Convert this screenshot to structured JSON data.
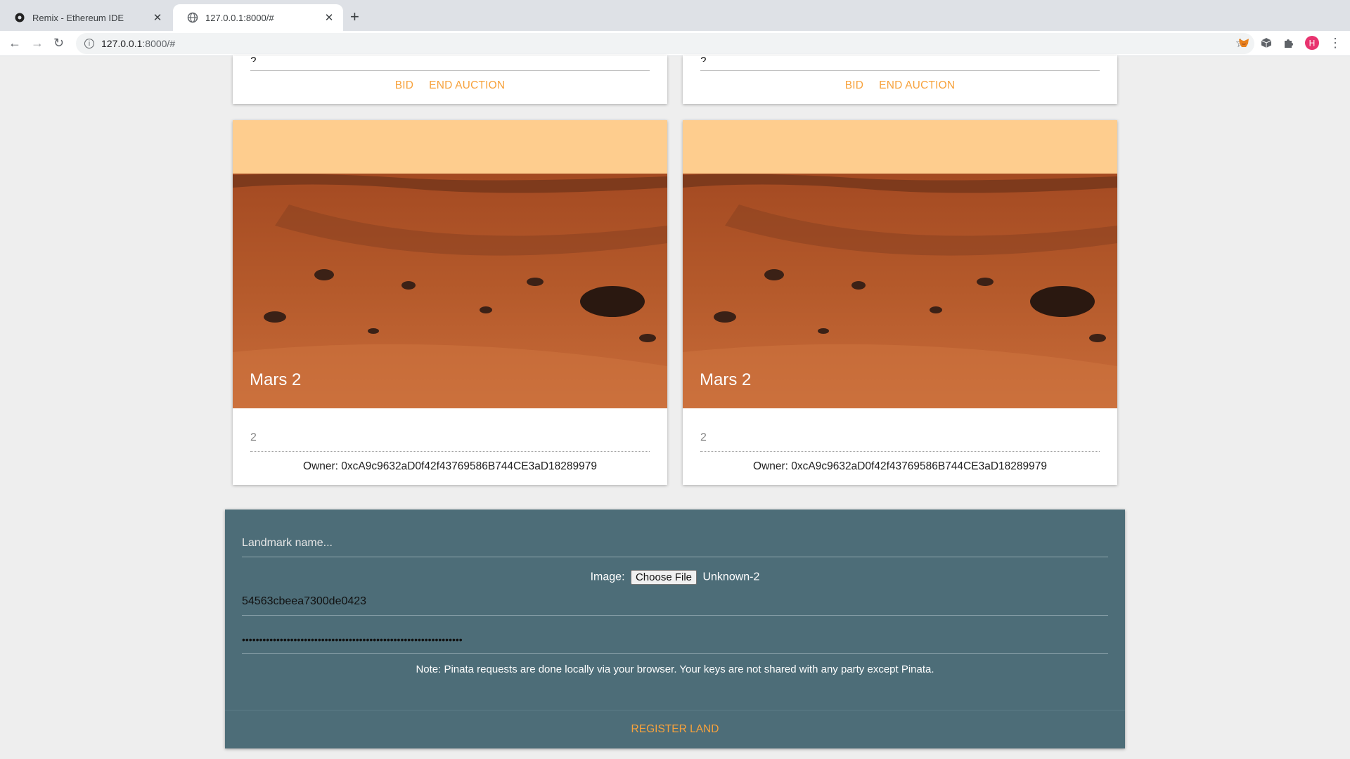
{
  "browser": {
    "tabs": [
      {
        "title": "Remix - Ethereum IDE",
        "active": false
      },
      {
        "title": "127.0.0.1:8000/#",
        "active": true
      }
    ],
    "address": {
      "host": "127.0.0.1",
      "rest": ":8000/#"
    }
  },
  "top_cards": [
    {
      "value": "2",
      "bid_label": "BID",
      "end_label": "END AUCTION"
    },
    {
      "value": "2",
      "bid_label": "BID",
      "end_label": "END AUCTION"
    }
  ],
  "land_cards": [
    {
      "title": "Mars 2",
      "value": "2",
      "owner": "Owner: 0xcA9c9632aD0f42f43769586B744CE3aD18289979"
    },
    {
      "title": "Mars 2",
      "value": "2",
      "owner": "Owner: 0xcA9c9632aD0f42f43769586B744CE3aD18289979"
    }
  ],
  "form": {
    "name_placeholder": "Landmark name...",
    "image_label": "Image:",
    "choose_file": "Choose File",
    "file_name": "Unknown-2",
    "api_key": "54563cbeea7300de0423",
    "secret": "••••••••••••••••••••••••••••••••••••••••••••••••••••••••••••••••",
    "note": "Note: Pinata requests are done locally via your browser. Your keys are not shared with any party except Pinata.",
    "register_label": "REGISTER LAND"
  },
  "colors": {
    "accent": "#f7a23c",
    "form_bg": "#4d6d78",
    "page_bg": "#eeeeee"
  }
}
